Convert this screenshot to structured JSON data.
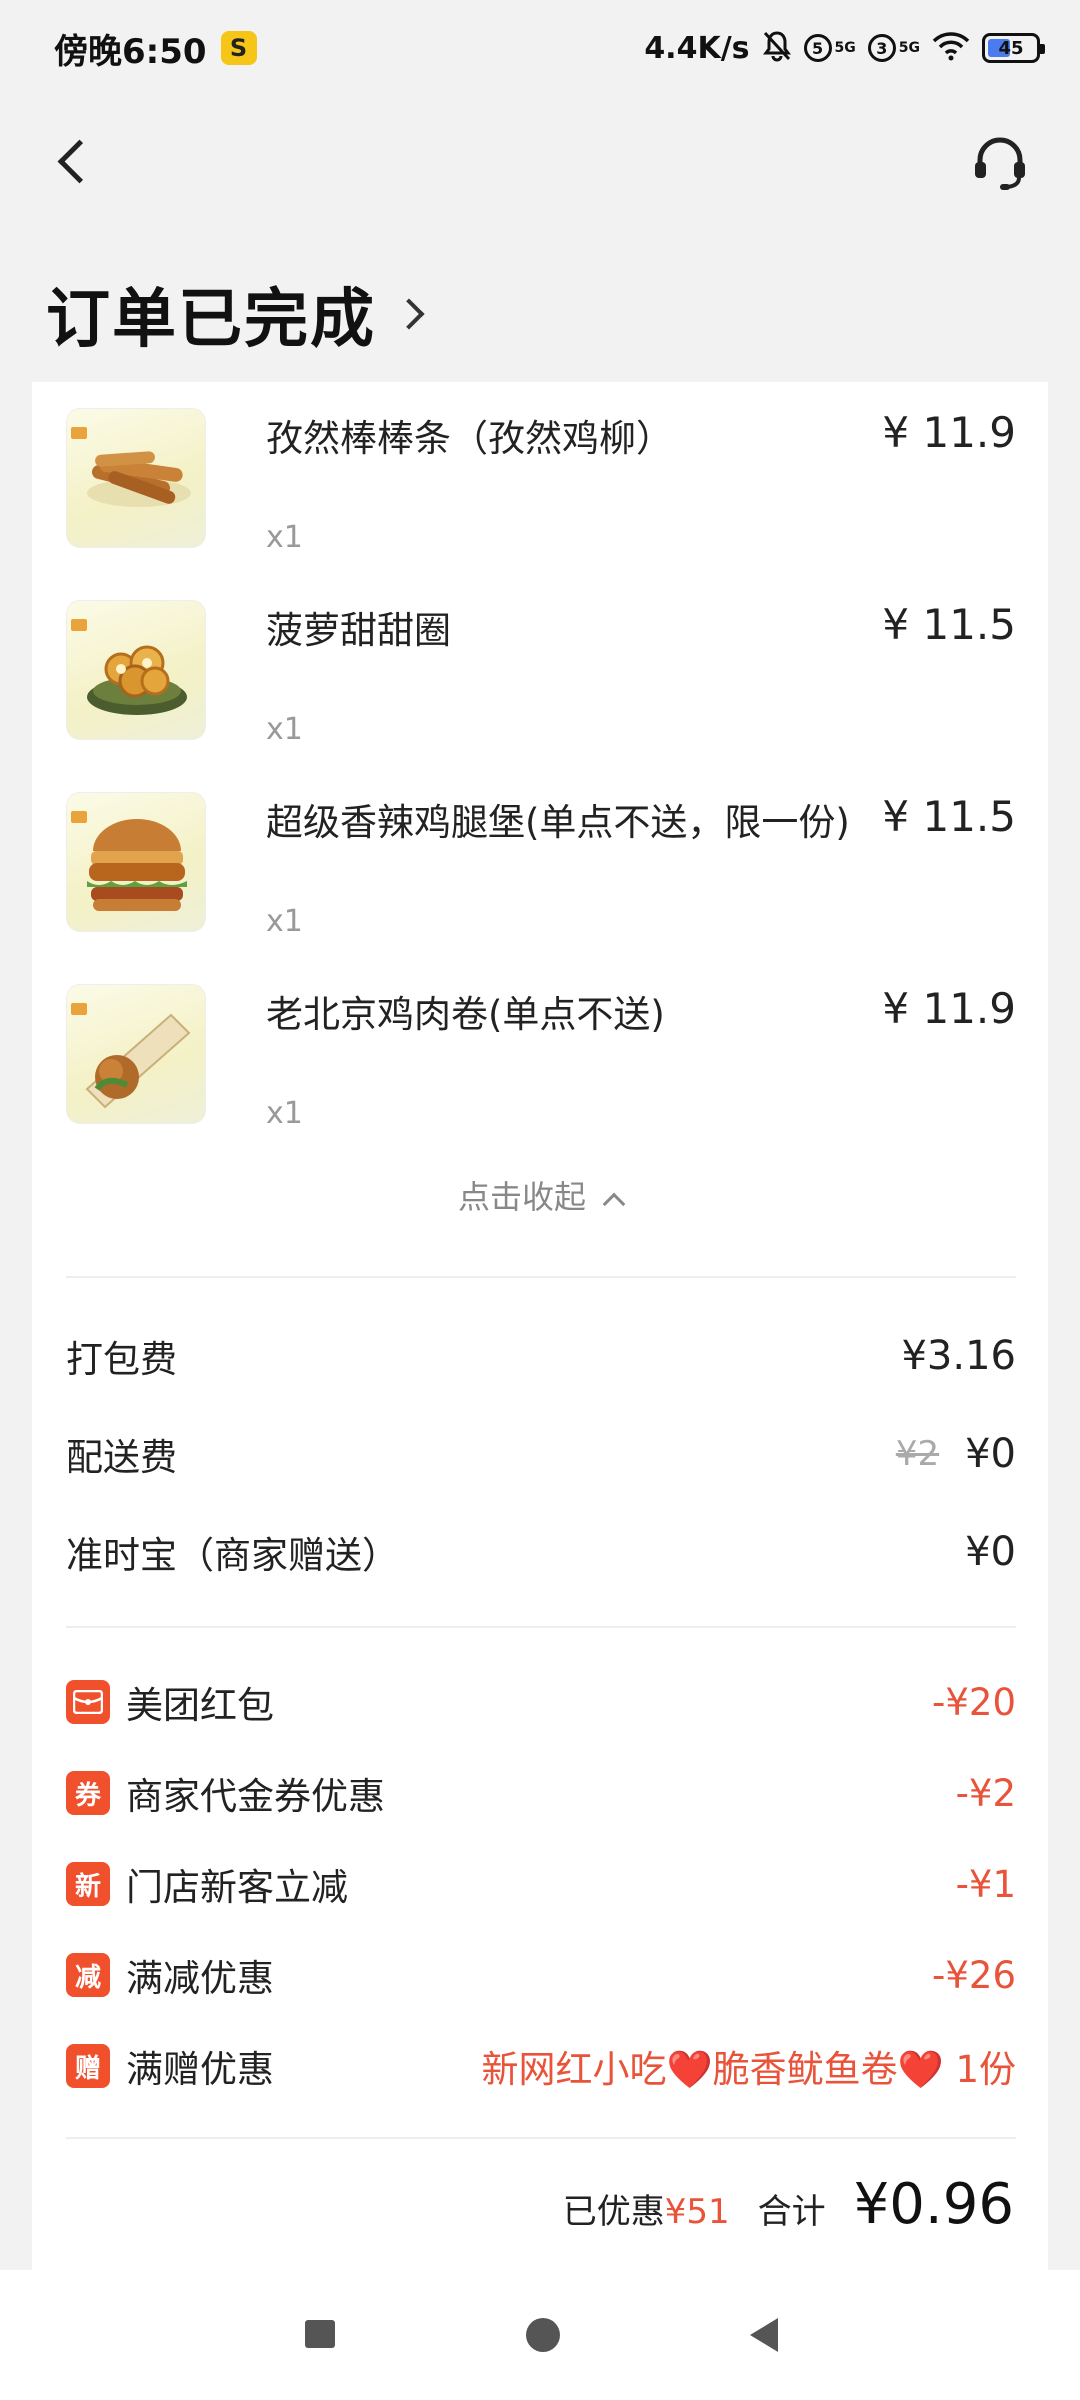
{
  "status_bar": {
    "time": "傍晚6:50",
    "app_badge": "S",
    "network_speed": "4.4K/s",
    "sim1": "5",
    "sim2": "3",
    "sim_tag": "5G",
    "battery": "45"
  },
  "header": {
    "title": "订单已完成"
  },
  "items": [
    {
      "name": "孜然棒棒条（孜然鸡柳）",
      "qty": "x1",
      "price": "¥ 11.9",
      "image": "fried-chicken-strips"
    },
    {
      "name": "菠萝甜甜圈",
      "qty": "x1",
      "price": "¥ 11.5",
      "image": "pineapple-rings"
    },
    {
      "name": "超级香辣鸡腿堡(单点不送，限一份)",
      "qty": "x1",
      "price": "¥ 11.5",
      "image": "spicy-chicken-burger"
    },
    {
      "name": "老北京鸡肉卷(单点不送)",
      "qty": "x1",
      "price": "¥ 11.9",
      "image": "chicken-wrap"
    }
  ],
  "collapse_label": "点击收起",
  "fees": [
    {
      "label": "打包费",
      "value": "¥3.16",
      "original": ""
    },
    {
      "label": "配送费",
      "value": "¥0",
      "original": "¥2"
    },
    {
      "label": "准时宝（商家赠送）",
      "value": "¥0",
      "original": ""
    }
  ],
  "discounts": [
    {
      "icon": "",
      "icon_name": "red-packet-icon",
      "label": "美团红包",
      "value": "-¥20"
    },
    {
      "icon": "券",
      "icon_name": "coupon-icon",
      "label": "商家代金券优惠",
      "value": "-¥2"
    },
    {
      "icon": "新",
      "icon_name": "new-customer-icon",
      "label": "门店新客立减",
      "value": "-¥1"
    },
    {
      "icon": "减",
      "icon_name": "discount-icon",
      "label": "满减优惠",
      "value": "-¥26"
    },
    {
      "icon": "赠",
      "icon_name": "gift-icon",
      "label": "满赠优惠",
      "value": "新网红小吃❤️脆香鱿鱼卷❤️ 1份"
    }
  ],
  "summary": {
    "saved_label": "已优惠",
    "saved_amount": "¥51",
    "total_label": "合计",
    "total_value": "¥0.96"
  },
  "colors": {
    "accent_red": "#e8533a",
    "icon_orange": "#f0502c",
    "background": "#f2f2f2"
  }
}
